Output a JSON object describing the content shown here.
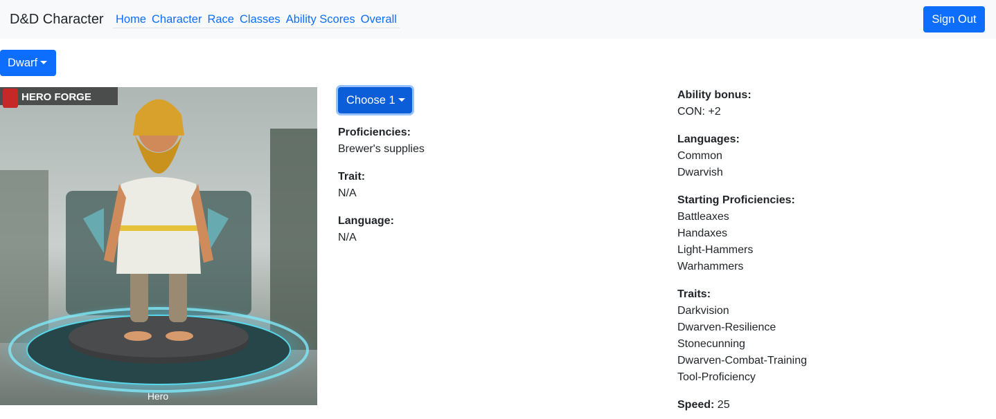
{
  "navbar": {
    "brand": "D&D Character",
    "links": [
      "Home",
      "Character",
      "Race",
      "Classes",
      "Ability Scores",
      "Overall"
    ],
    "sign_out": "Sign Out"
  },
  "race_dropdown": {
    "selected": "Dwarf"
  },
  "hero_image": {
    "logo_text": "HERO FORGE",
    "caption": "Hero"
  },
  "choice": {
    "dropdown_label": "Choose 1",
    "proficiencies_label": "Proficiencies:",
    "proficiencies_value": "Brewer's supplies",
    "trait_label": "Trait:",
    "trait_value": "N/A",
    "language_label": "Language:",
    "language_value": "N/A"
  },
  "race_info": {
    "ability_bonus_label": "Ability bonus:",
    "ability_bonus_value": "CON: +2",
    "languages_label": "Languages:",
    "languages": [
      "Common",
      "Dwarvish"
    ],
    "starting_proficiencies_label": "Starting Proficiencies:",
    "starting_proficiencies": [
      "Battleaxes",
      "Handaxes",
      "Light-Hammers",
      "Warhammers"
    ],
    "traits_label": "Traits:",
    "traits": [
      "Darkvision",
      "Dwarven-Resilience",
      "Stonecunning",
      "Dwarven-Combat-Training",
      "Tool-Proficiency"
    ],
    "speed_label": "Speed:",
    "speed_value": "25"
  },
  "colors": {
    "primary": "#0d6efd",
    "navbar_bg": "#f8f9fa",
    "text": "#212529"
  }
}
